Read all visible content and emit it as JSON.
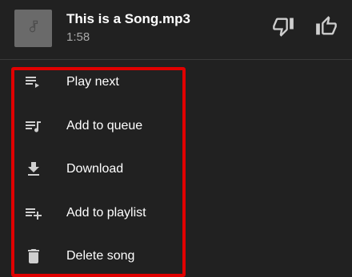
{
  "song": {
    "title": "This is a Song.mp3",
    "duration": "1:58",
    "thumbnail_icon": "music-note-icon"
  },
  "actions": {
    "dislike_icon": "thumb-down-icon",
    "like_icon": "thumb-up-icon"
  },
  "menu": {
    "items": [
      {
        "label": "Play next",
        "icon": "play-next-icon"
      },
      {
        "label": "Add to queue",
        "icon": "add-to-queue-icon"
      },
      {
        "label": "Download",
        "icon": "download-icon"
      },
      {
        "label": "Add to playlist",
        "icon": "add-to-playlist-icon"
      },
      {
        "label": "Delete song",
        "icon": "delete-icon"
      }
    ]
  },
  "colors": {
    "background": "#212121",
    "highlight": "#e00000",
    "secondary_text": "#a8a8a8",
    "thumbnail": "#6a6a6a"
  }
}
